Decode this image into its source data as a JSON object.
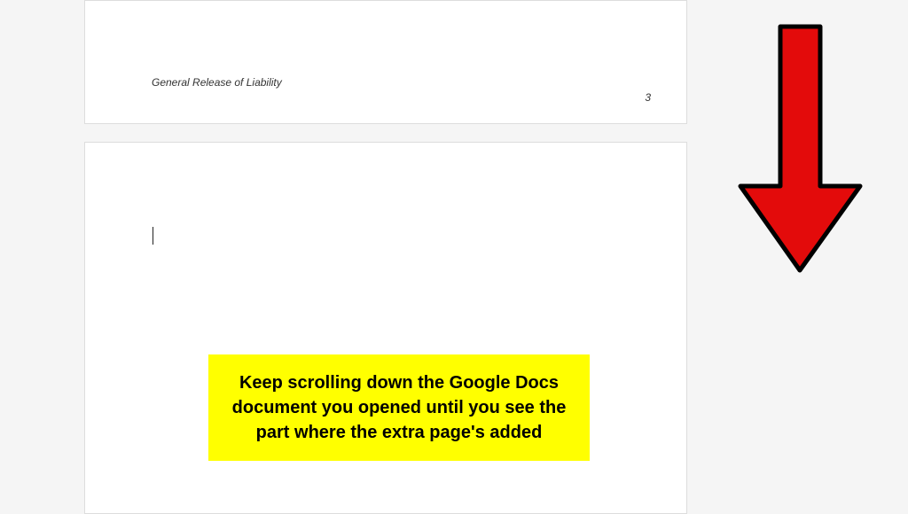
{
  "document": {
    "footer_title": "General Release of Liability",
    "page_number": "3"
  },
  "annotation": {
    "callout_text": "Keep scrolling down the Google Docs document you opened until you see the part where the extra page's added",
    "arrow_color": "#e30b0b",
    "arrow_stroke": "#000000"
  }
}
